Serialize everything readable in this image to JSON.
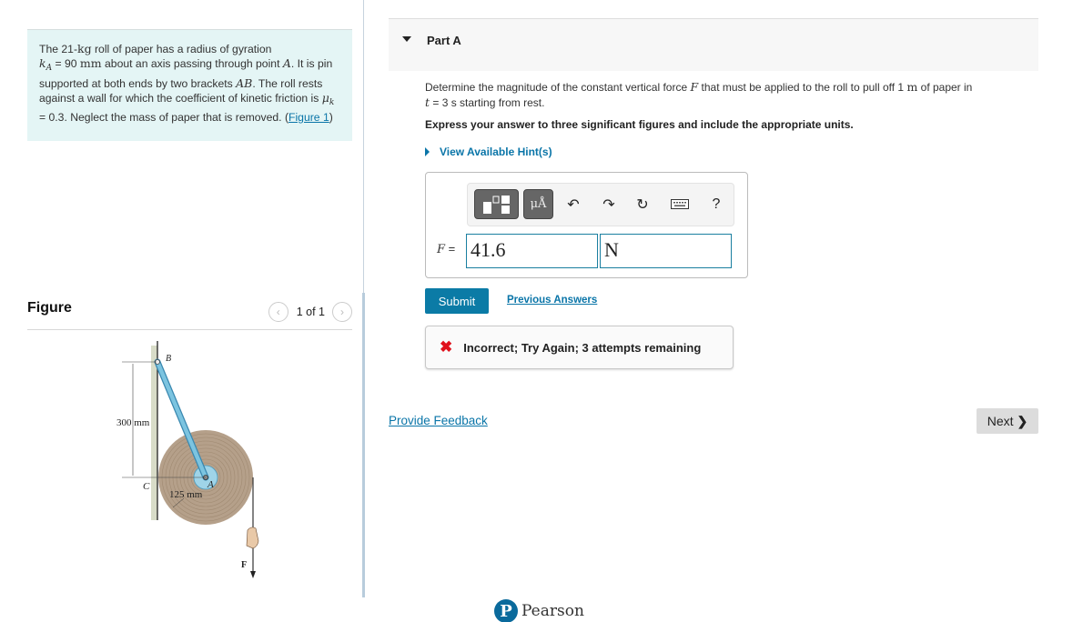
{
  "problem": {
    "t1": "The 21-",
    "kg": "kg",
    "t2": " roll of paper has a radius of gyration",
    "k": "k",
    "k_sub": "A",
    "t3": " = 90 ",
    "mm": "mm",
    "t4": " about an axis passing through point ",
    "A": "A",
    "t5": ". It is pin supported at both ends by two brackets ",
    "AB": "AB",
    "t6": ". The roll rests against a wall for which the coefficient of kinetic friction is ",
    "mu": "μ",
    "mu_sub": "k",
    "t7": " = 0.3. Neglect the mass of paper that is removed. (",
    "figure_link": "Figure 1",
    "t8": ")"
  },
  "figure": {
    "title": "Figure",
    "pager": "1 of 1",
    "prev_icon": "chevron-left-icon",
    "next_icon": "chevron-right-icon",
    "labels": {
      "B": "B",
      "C": "C",
      "A": "A",
      "F": "F",
      "dim_300": "300 mm",
      "dim_125": "125 mm"
    }
  },
  "part": {
    "title": "Part A",
    "q1": "Determine the magnitude of the constant vertical force ",
    "F": "F",
    "q2": " that must be applied to the roll to pull off 1 ",
    "m": "m",
    "q3": " of paper in ",
    "t": "t",
    "q4": " = 3 s starting from rest.",
    "instruction": "Express your answer to three significant figures and include the appropriate units.",
    "hints": "View Available Hint(s)"
  },
  "answer": {
    "toolbar": {
      "templates_icon": "templates-icon",
      "units_label": "μÅ",
      "undo_icon": "undo-icon",
      "redo_icon": "redo-icon",
      "reset_icon": "reset-icon",
      "keyboard_icon": "keyboard-icon",
      "help_label": "?"
    },
    "var_label": "F",
    "equals": " =",
    "value": "41.6",
    "unit": "N"
  },
  "actions": {
    "submit": "Submit",
    "previous_answers": "Previous Answers"
  },
  "feedback": {
    "status": "incorrect",
    "text": "Incorrect; Try Again; 3 attempts remaining",
    "color": "#e0101b"
  },
  "footer": {
    "provide_feedback": "Provide Feedback",
    "next": "Next",
    "brand": "Pearson"
  },
  "colors": {
    "accent": "#0b7ba6",
    "link": "#0a75a8",
    "problem_bg": "#e4f5f5"
  }
}
